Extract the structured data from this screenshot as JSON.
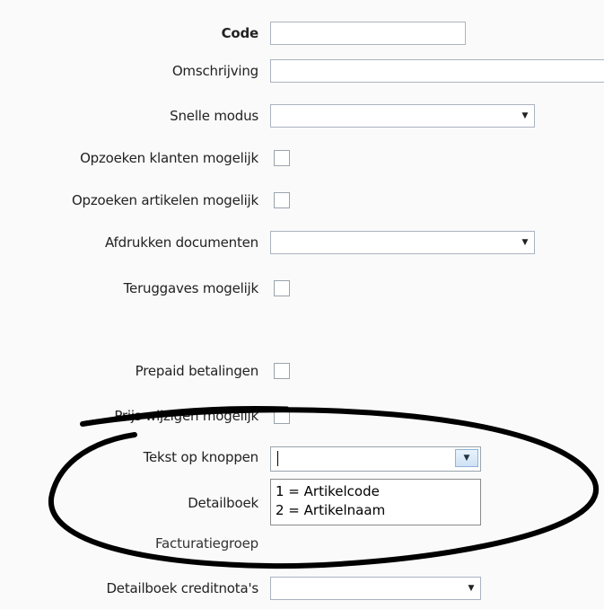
{
  "fields": {
    "code": {
      "label": "Code",
      "value": ""
    },
    "omschrijving": {
      "label": "Omschrijving",
      "value": ""
    },
    "snelle_modus": {
      "label": "Snelle modus",
      "value": ""
    },
    "opzoeken_klanten": {
      "label": "Opzoeken klanten mogelijk",
      "checked": false
    },
    "opzoeken_artikelen": {
      "label": "Opzoeken artikelen mogelijk",
      "checked": false
    },
    "afdrukken_documenten": {
      "label": "Afdrukken documenten",
      "value": ""
    },
    "teruggaves": {
      "label": "Teruggaves mogelijk",
      "checked": false
    },
    "prepaid": {
      "label": "Prepaid betalingen",
      "checked": false
    },
    "prijs_wijzigen": {
      "label": "Prijs wijzigen mogelijk",
      "checked": false
    },
    "tekst_op_knoppen": {
      "label": "Tekst op knoppen",
      "value": "",
      "options": [
        "1 = Artikelcode",
        "2 = Artikelnaam"
      ]
    },
    "detailboek": {
      "label": "Detailboek"
    },
    "facturatiegroep": {
      "label": "Facturatiegroep"
    },
    "detailboek_creditnotas": {
      "label": "Detailboek creditnota's",
      "value": ""
    }
  },
  "icons": {
    "dropdown_arrow": "chevron-down-icon"
  },
  "colors": {
    "annotation_ellipse": "#000000",
    "field_border": "#aab3bf",
    "dropdown_button": "#cfe2f5"
  }
}
